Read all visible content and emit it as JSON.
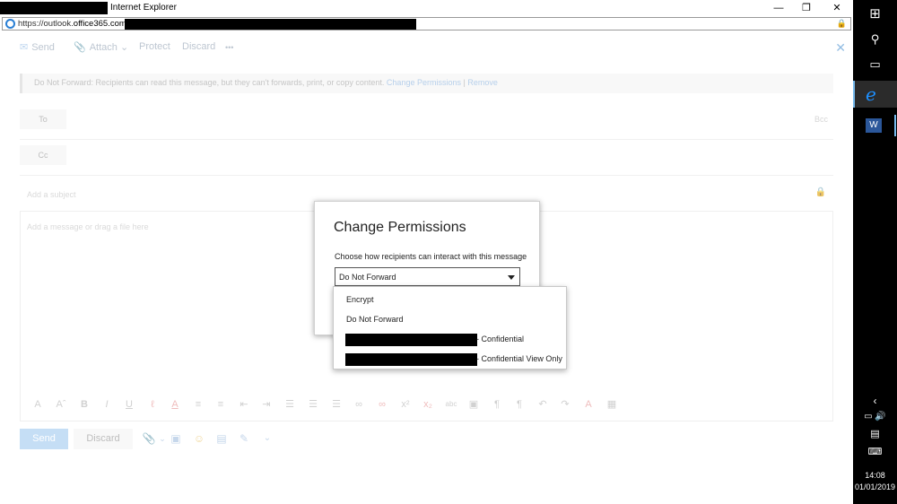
{
  "browser": {
    "title": "Internet Explorer",
    "url_prefix": "https://outlook.",
    "url_domain": "office365.com",
    "controls": {
      "minimize": "—",
      "restore": "❐",
      "close": "✕"
    }
  },
  "toolbar": {
    "send_label": "Send",
    "attach_label": "Attach",
    "protect_label": "Protect",
    "discard_label": "Discard",
    "more_label": "•••",
    "close_label": "✕"
  },
  "info_bar": {
    "text": "Do Not Forward: Recipients can read this message, but they can't forwards, print, or copy content.",
    "change_permissions": "Change Permissions",
    "separator": "|",
    "remove": "Remove"
  },
  "fields": {
    "to_label": "To",
    "cc_label": "Cc",
    "bcc_label": "Bcc",
    "subject_placeholder": "Add a subject",
    "body_placeholder": "Add a message or drag a file here"
  },
  "bottom": {
    "send_label": "Send",
    "discard_label": "Discard"
  },
  "dialog": {
    "title": "Change Permissions",
    "subtitle": "Choose how recipients can interact with this message",
    "selected": "Do Not Forward",
    "options": [
      {
        "label": "Encrypt"
      },
      {
        "label": "Do Not Forward"
      },
      {
        "suffix": "- Confidential"
      },
      {
        "suffix": "- Confidential View Only"
      }
    ]
  },
  "taskbar": {
    "time": "14:08",
    "date": "01/01/2019",
    "word_letter": "W",
    "ie_letter": "e"
  },
  "colors": {
    "accent": "#0078d7",
    "link": "#8fb6e0",
    "send_button": "#a7ccf0"
  }
}
